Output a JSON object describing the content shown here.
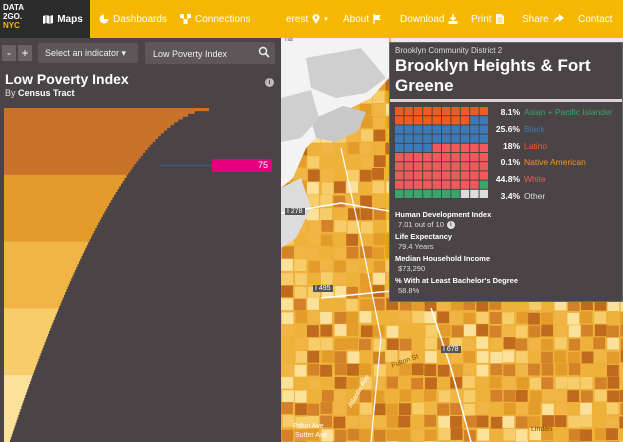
{
  "header": {
    "logo": [
      "DATA",
      "2GO.",
      "NYC"
    ],
    "maps_label": "Maps",
    "dashboards_label": "Dashboards",
    "connections_label": "Connections",
    "interest_label": "erest",
    "about_label": "About",
    "download_label": "Download",
    "print_label": "Print",
    "share_label": "Share",
    "contact_label": "Contact"
  },
  "toolbar": {
    "zoom_out": "-",
    "zoom_in": "+",
    "indicator_label": "Select an indicator ▾",
    "search_value": "Low Poverty Index"
  },
  "panel": {
    "title": "Low Poverty Index",
    "subtitle_prefix": "By ",
    "subtitle_bold": "Census Tract",
    "marker_value": "75"
  },
  "map": {
    "highway_labels": [
      "I 278",
      "I 495",
      "I 678"
    ],
    "corner_label": "na",
    "names": [
      "Pitkin Ave",
      "Sutter Ave",
      "Atlantic Ave",
      "Fulton St",
      "Linden"
    ]
  },
  "tooltip": {
    "district": "Brooklyn Community District 2",
    "title": "Brooklyn Heights & Fort Greene",
    "legend": [
      {
        "pct": "8.1%",
        "label": "Asian + Pacific Islander",
        "color": "#3aa56b"
      },
      {
        "pct": "25.6%",
        "label": "Black",
        "color": "#3a7ab8"
      },
      {
        "pct": "18%",
        "label": "Latino",
        "color": "#f15a24"
      },
      {
        "pct": "0.1%",
        "label": "Native American",
        "color": "#f7941d"
      },
      {
        "pct": "44.8%",
        "label": "White",
        "color": "#f15a5a"
      },
      {
        "pct": "3.4%",
        "label": "Other",
        "color": "#dddddd"
      }
    ],
    "stats": [
      {
        "label": "Human Development Index",
        "value": "7.01 out of 10"
      },
      {
        "label": "Life Expectancy",
        "value": "79.4 Years"
      },
      {
        "label": "Median Household Income",
        "value": "$73,290"
      },
      {
        "label": "% With at Least Bachelor's Degree",
        "value": "58.8%"
      }
    ]
  }
}
